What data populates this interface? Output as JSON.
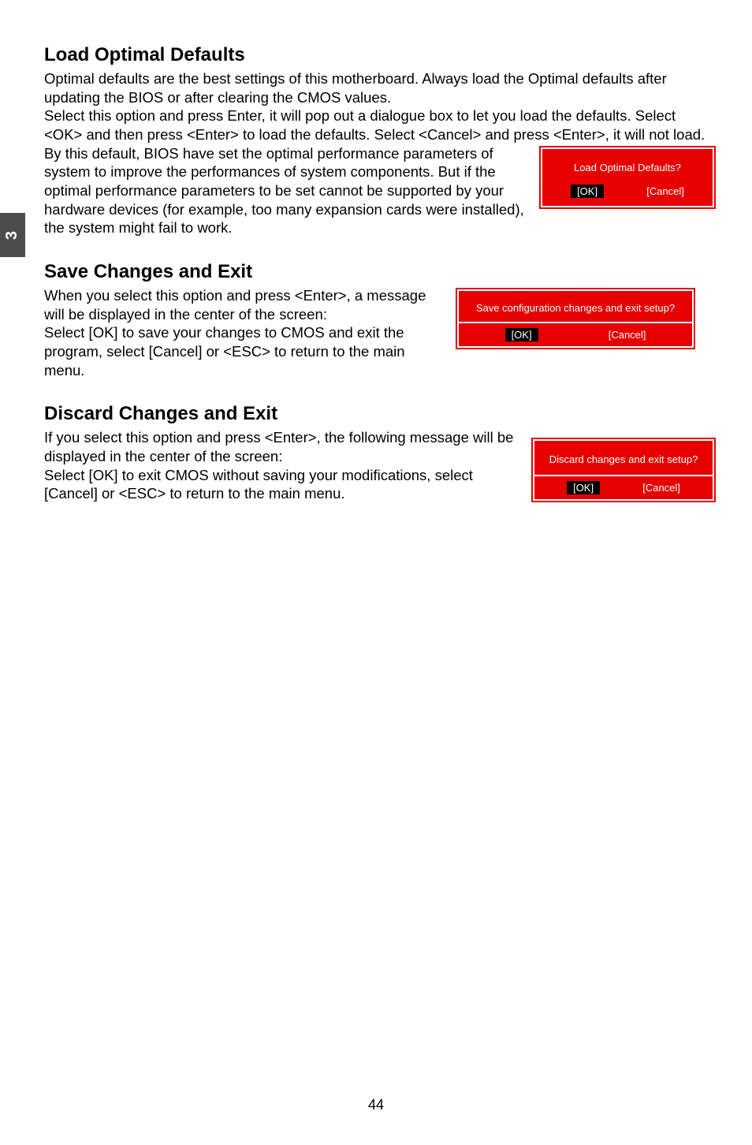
{
  "side_tab": "3",
  "page_number": "44",
  "section1": {
    "heading": "Load Optimal Defaults",
    "p1": "Optimal defaults are the best settings of this motherboard. Always load the Optimal defaults after updating the BIOS or after clearing the CMOS values.",
    "p2": "Select this option and press Enter, it will pop out a dialogue box to let you load the defaults. Select <OK> and then press <Enter> to load the defaults. Select <Cancel> and press <Enter>, it will not load.",
    "p3": "By this default, BIOS have set the optimal performance parameters of system to improve the performances of system components. But if the optimal performance parameters to be set cannot be supported by your hardware devices (for example, too many expansion cards were installed), the system might fail to work.",
    "dialog": {
      "title": "Load Optimal Defaults?",
      "ok": "[OK]",
      "cancel": "[Cancel]"
    }
  },
  "section2": {
    "heading": "Save Changes and Exit",
    "p1": "When you select this option and press <Enter>, a message will be displayed in the center of the screen:",
    "p2": "Select [OK] to save your changes to CMOS and exit the program, select [Cancel] or <ESC> to return to the main menu.",
    "dialog": {
      "title": "Save configuration changes and exit setup?",
      "ok": "[OK]",
      "cancel": "[Cancel]"
    }
  },
  "section3": {
    "heading": "Discard Changes and Exit",
    "p1": "If you select this option and press <Enter>, the following message will be displayed in the center of the screen:",
    "p2": "Select [OK] to exit CMOS without saving your modifications, select [Cancel] or <ESC> to return to the main menu.",
    "dialog": {
      "title": "Discard changes and exit setup?",
      "ok": "[OK]",
      "cancel": "[Cancel]"
    }
  }
}
